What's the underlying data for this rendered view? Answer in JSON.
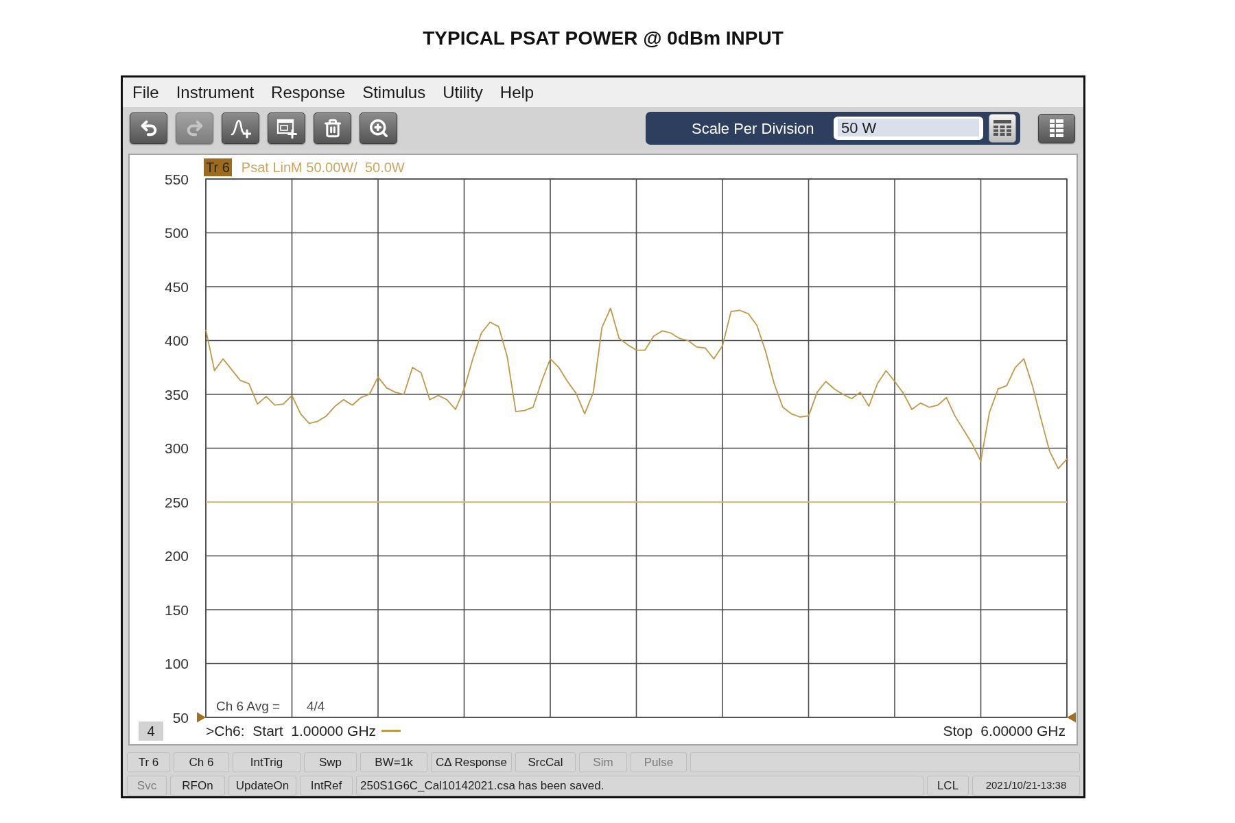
{
  "title": "TYPICAL PSAT POWER @ 0dBm INPUT",
  "window": {
    "menu": [
      "File",
      "Instrument",
      "Response",
      "Stimulus",
      "Utility",
      "Help"
    ],
    "toolbar": {
      "buttons": [
        {
          "kind": "undo",
          "disabled": false
        },
        {
          "kind": "redo",
          "disabled": true
        },
        {
          "kind": "add_trace",
          "disabled": false
        },
        {
          "kind": "add_channel",
          "disabled": false
        },
        {
          "kind": "delete",
          "disabled": false
        },
        {
          "kind": "zoom",
          "disabled": false
        }
      ],
      "scale": {
        "label": "Scale Per Division",
        "value": "50 W"
      }
    },
    "plot": {
      "trace_label": "Psat LinM 50.00W/  50.0W",
      "average_label": "Ch 6 Avg =",
      "average_value": "4/4",
      "window_number": "4",
      "start": ">Ch6:  Start  1.00000 GHz",
      "stop": "Stop  6.00000 GHz",
      "chart_data": {
        "type": "line",
        "categories": [
          null,
          null,
          null,
          null,
          null,
          null,
          null,
          null,
          null,
          null,
          null,
          null,
          null,
          null,
          null,
          null,
          null,
          null,
          null,
          null,
          null,
          null,
          null,
          null,
          null,
          null,
          null,
          null,
          null,
          null,
          null,
          null,
          null,
          null,
          null,
          null,
          null,
          null,
          null,
          null,
          null,
          null,
          null,
          null,
          null,
          null,
          null,
          null,
          null,
          null,
          null,
          null,
          null,
          null,
          null,
          null,
          null,
          null,
          null,
          null,
          null,
          null,
          null,
          null,
          null,
          null,
          null,
          null,
          null,
          null,
          null,
          null,
          null,
          null,
          null,
          null,
          null,
          null,
          null,
          null,
          null,
          null,
          null,
          null,
          null,
          null,
          null,
          null,
          null,
          null,
          null,
          null,
          null,
          null,
          null,
          null,
          null,
          null,
          null,
          null,
          null
        ],
        "series": [
          {
            "name": "Tr 6",
            "color": "#bf9848",
            "values": [
              410,
              372,
              383,
              373,
              363,
              360,
              341,
              348,
              340,
              341,
              349,
              332,
              323,
              325,
              330,
              339,
              345,
              340,
              347,
              350,
              366,
              356,
              352,
              350,
              375,
              370,
              345,
              349,
              345,
              336,
              355,
              383,
              407,
              417,
              413,
              385,
              334,
              335,
              338,
              362,
              383,
              375,
              362,
              351,
              332,
              352,
              412,
              430,
              402,
              396,
              391,
              391,
              404,
              409,
              407,
              402,
              400,
              394,
              393,
              383,
              395,
              427,
              428,
              425,
              414,
              390,
              360,
              338,
              332,
              329,
              330,
              352,
              362,
              355,
              350,
              346,
              352,
              339,
              360,
              372,
              362,
              351,
              336,
              342,
              338,
              340,
              347,
              330,
              317,
              304,
              288,
              333,
              355,
              358,
              375,
              383,
              358,
              327,
              297,
              281,
              290
            ]
          }
        ],
        "ylim": [
          50,
          550
        ],
        "yticks": [
          50,
          100,
          150,
          200,
          250,
          300,
          350,
          400,
          450,
          500,
          550
        ],
        "grid": true,
        "ref_lines": [
          {
            "axis": "y",
            "value": 250
          }
        ]
      }
    },
    "status_bar": {
      "row_1": [
        {
          "kind": "button",
          "text": "Tr 6",
          "disabled": false
        },
        {
          "kind": "button",
          "text": "Ch 6",
          "disabled": false
        },
        {
          "kind": "button",
          "text": "IntTrig",
          "disabled": false
        },
        {
          "kind": "button",
          "text": "Swp",
          "disabled": false
        },
        {
          "kind": "button",
          "text": "BW=1k",
          "disabled": false
        },
        {
          "kind": "button",
          "text": "CΔ Response",
          "disabled": false
        },
        {
          "kind": "button",
          "text": "SrcCal",
          "disabled": false
        },
        {
          "kind": "button",
          "text": "Sim",
          "disabled": true
        },
        {
          "kind": "button",
          "text": "Pulse",
          "disabled": true
        }
      ],
      "row_2": [
        {
          "kind": "button",
          "text": "Svc",
          "disabled": true
        },
        {
          "kind": "button",
          "text": "RFOn",
          "disabled": false
        },
        {
          "kind": "button",
          "text": "UpdateOn",
          "disabled": false
        },
        {
          "kind": "button",
          "text": "IntRef",
          "disabled": false
        },
        {
          "kind": "message",
          "text": "250S1G6C_Cal10142021.csa has been saved.",
          "disabled": false
        },
        {
          "kind": "indicator",
          "text": "LCL",
          "disabled": false
        },
        {
          "kind": "datetime",
          "text": "2021/10/21-13:38",
          "disabled": false
        }
      ]
    }
  }
}
